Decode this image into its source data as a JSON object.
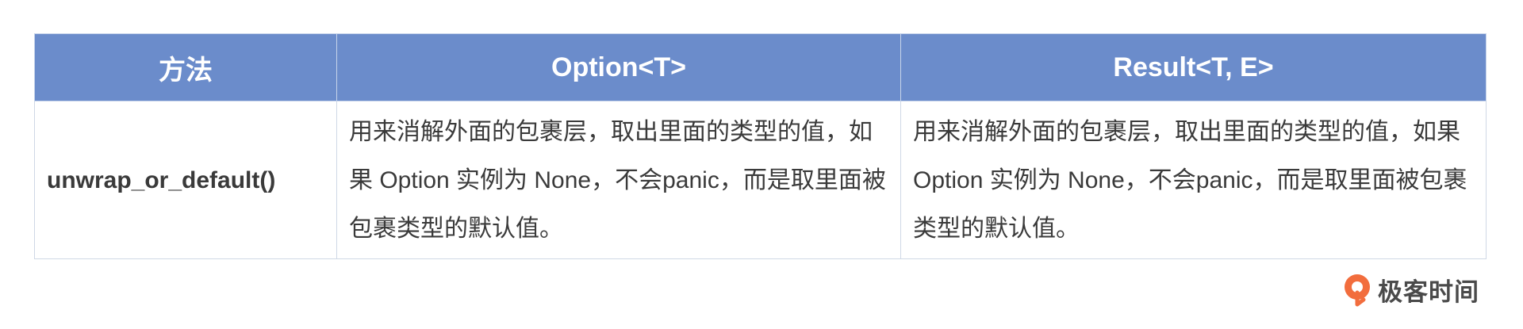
{
  "table": {
    "headers": [
      "方法",
      "Option<T>",
      "Result<T, E>"
    ],
    "rows": [
      {
        "method": "unwrap_or_default()",
        "option_desc": "用来消解外面的包裹层，取出里面的类型的值，如果 Option 实例为 None，不会panic，而是取里面被包裹类型的默认值。",
        "result_desc": "用来消解外面的包裹层，取出里面的类型的值，如果 Option 实例为 None，不会panic，而是取里面被包裹类型的默认值。"
      }
    ]
  },
  "brand": {
    "name": "极客时间",
    "icon": "geektime-logo-icon",
    "accent_color": "#f26d3d"
  },
  "colors": {
    "header_bg": "#6b8ccb",
    "header_text": "#ffffff",
    "border": "#cfd8e6"
  }
}
